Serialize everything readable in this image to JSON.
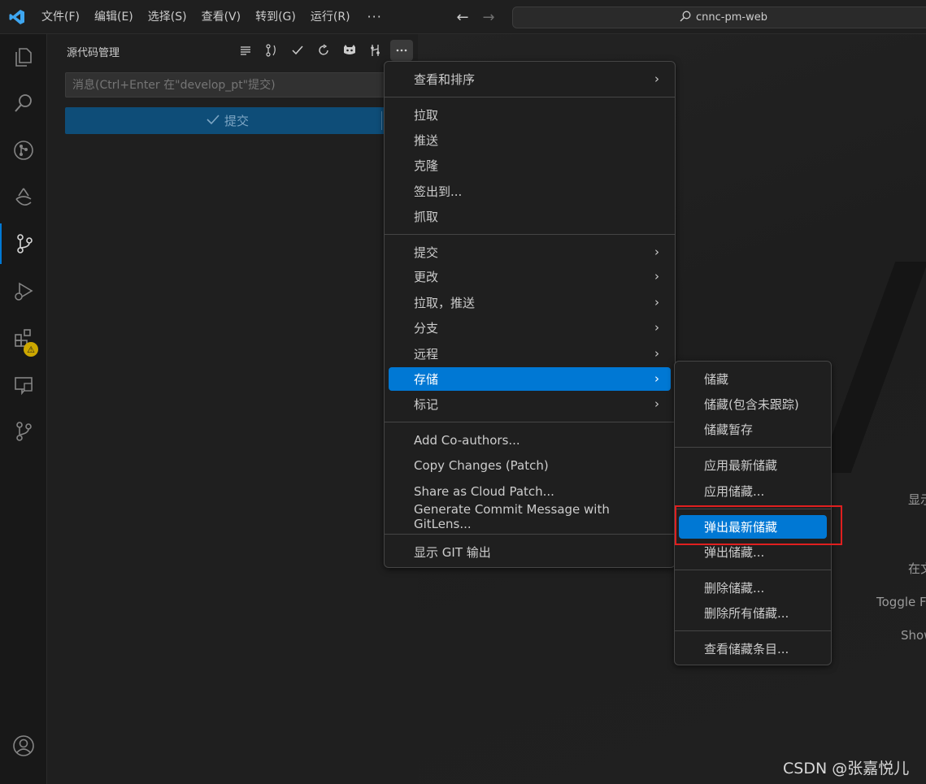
{
  "titlebar": {
    "menus": [
      "文件(F)",
      "编辑(E)",
      "选择(S)",
      "查看(V)",
      "转到(G)",
      "运行(R)"
    ],
    "more": "···",
    "search_text": "cnnc-pm-web"
  },
  "sidebar": {
    "title": "源代码管理",
    "message_placeholder": "消息(Ctrl+Enter 在\"develop_pt\"提交)",
    "commit_label": "提交"
  },
  "main_menu": {
    "items": [
      {
        "label": "查看和排序",
        "submenu": true
      },
      {
        "label": "拉取",
        "submenu": false
      },
      {
        "label": "推送",
        "submenu": false
      },
      {
        "label": "克隆",
        "submenu": false
      },
      {
        "label": "签出到...",
        "submenu": false
      },
      {
        "label": "抓取",
        "submenu": false
      },
      {
        "label": "提交",
        "submenu": true
      },
      {
        "label": "更改",
        "submenu": true
      },
      {
        "label": "拉取，推送",
        "submenu": true
      },
      {
        "label": "分支",
        "submenu": true
      },
      {
        "label": "远程",
        "submenu": true
      },
      {
        "label": "存储",
        "submenu": true
      },
      {
        "label": "标记",
        "submenu": true
      },
      {
        "label": "Add Co-authors...",
        "submenu": false
      },
      {
        "label": "Copy Changes (Patch)",
        "submenu": false
      },
      {
        "label": "Share as Cloud Patch...",
        "submenu": false
      },
      {
        "label": "Generate Commit Message with GitLens...",
        "submenu": false
      },
      {
        "label": "显示 GIT 输出",
        "submenu": false
      }
    ]
  },
  "stash_menu": {
    "items": [
      {
        "label": "储藏"
      },
      {
        "label": "储藏(包含未跟踪)"
      },
      {
        "label": "储藏暂存"
      },
      {
        "label": "应用最新储藏"
      },
      {
        "label": "应用储藏..."
      },
      {
        "label": "弹出最新储藏"
      },
      {
        "label": "弹出储藏..."
      },
      {
        "label": "删除储藏..."
      },
      {
        "label": "删除所有储藏..."
      },
      {
        "label": "查看储藏条目..."
      }
    ]
  },
  "editor_hints": [
    "显示",
    "在文",
    "Toggle F",
    "Show"
  ],
  "watermark": "CSDN @张嘉悦儿",
  "colors": {
    "accent": "#0078d4",
    "highlight_border": "#e01f1f"
  }
}
